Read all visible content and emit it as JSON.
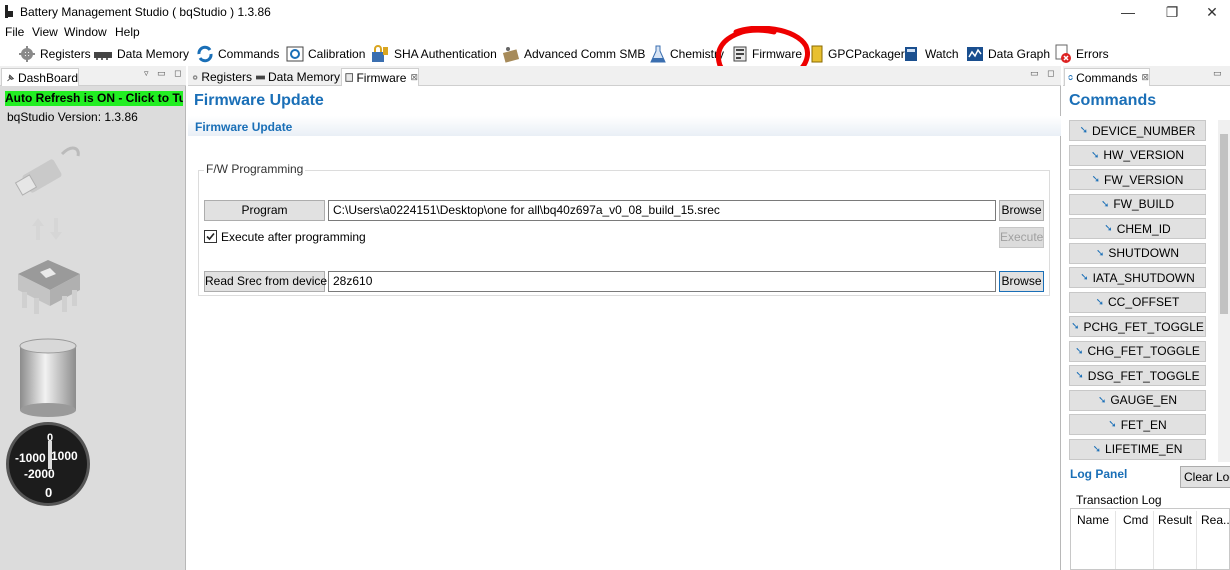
{
  "window": {
    "title": "Battery Management Studio ( bqStudio ) 1.3.86",
    "minimize_glyph": "—",
    "restore_glyph": "❐",
    "close_glyph": "✕"
  },
  "menu": [
    "File",
    "View",
    "Window",
    "Help"
  ],
  "toolbar": {
    "items": [
      {
        "label": "Registers",
        "icon": "gear-icon"
      },
      {
        "label": "Data Memory",
        "icon": "memory-chip-icon"
      },
      {
        "label": "Commands",
        "icon": "refresh-arrows-icon"
      },
      {
        "label": "Calibration",
        "icon": "calibration-icon"
      },
      {
        "label": "SHA Authentication",
        "icon": "lock-icon"
      },
      {
        "label": "Advanced Comm SMB",
        "icon": "network-icon"
      },
      {
        "label": "Chemistry",
        "icon": "flask-icon"
      },
      {
        "label": "Firmware",
        "icon": "firmware-chip-icon"
      },
      {
        "label": "GPCPackager",
        "icon": "package-icon"
      },
      {
        "label": "Watch",
        "icon": "book-icon"
      },
      {
        "label": "Data Graph",
        "icon": "graph-icon"
      },
      {
        "label": "Errors",
        "icon": "error-icon"
      }
    ]
  },
  "dashboard": {
    "tab_label": "DashBoard",
    "auto_refresh_text": "Auto Refresh is ON - Click to Tu",
    "version_label": "bqStudio Version:",
    "version_value": "1.3.86",
    "gauge": {
      "top": "0",
      "left": "-1000",
      "right": "1000",
      "lower": "-2000",
      "reading": "0"
    }
  },
  "editor_tabs": [
    {
      "label": "Registers",
      "icon": "gear-icon"
    },
    {
      "label": "Data Memory",
      "icon": "memory-chip-icon"
    },
    {
      "label": "Firmware",
      "icon": "firmware-chip-icon",
      "active": true,
      "close": "⊠"
    }
  ],
  "firmware": {
    "title": "Firmware Update",
    "subtitle": "Firmware Update",
    "group_label": "F/W Programming",
    "program_button": "Program",
    "program_path": "C:\\Users\\a0224151\\Desktop\\one for all\\bq40z697a_v0_08_build_15.srec",
    "browse_button_1": "Browse",
    "execute_checkbox_label": "Execute after programming",
    "execute_checked": true,
    "execute_button": "Execute",
    "read_srec_button": "Read Srec from device",
    "read_srec_value": "28z610",
    "browse_button_2": "Browse"
  },
  "commands_panel": {
    "tab_label": "Commands",
    "title": "Commands",
    "items": [
      "DEVICE_NUMBER",
      "HW_VERSION",
      "FW_VERSION",
      "FW_BUILD",
      "CHEM_ID",
      "SHUTDOWN",
      "IATA_SHUTDOWN",
      "CC_OFFSET",
      "PCHG_FET_TOGGLE",
      "CHG_FET_TOGGLE",
      "DSG_FET_TOGGLE",
      "GAUGE_EN",
      "FET_EN",
      "LIFETIME_EN"
    ]
  },
  "log_panel": {
    "title": "Log Panel",
    "clear_button": "Clear Log",
    "transaction_label": "Transaction Log",
    "columns": [
      "Name",
      "Cmd",
      "Result",
      "Rea..."
    ]
  },
  "colors": {
    "accent": "#1a6fb7",
    "auto_refresh_bg": "#22ee22",
    "annotation": "#ee0000"
  }
}
